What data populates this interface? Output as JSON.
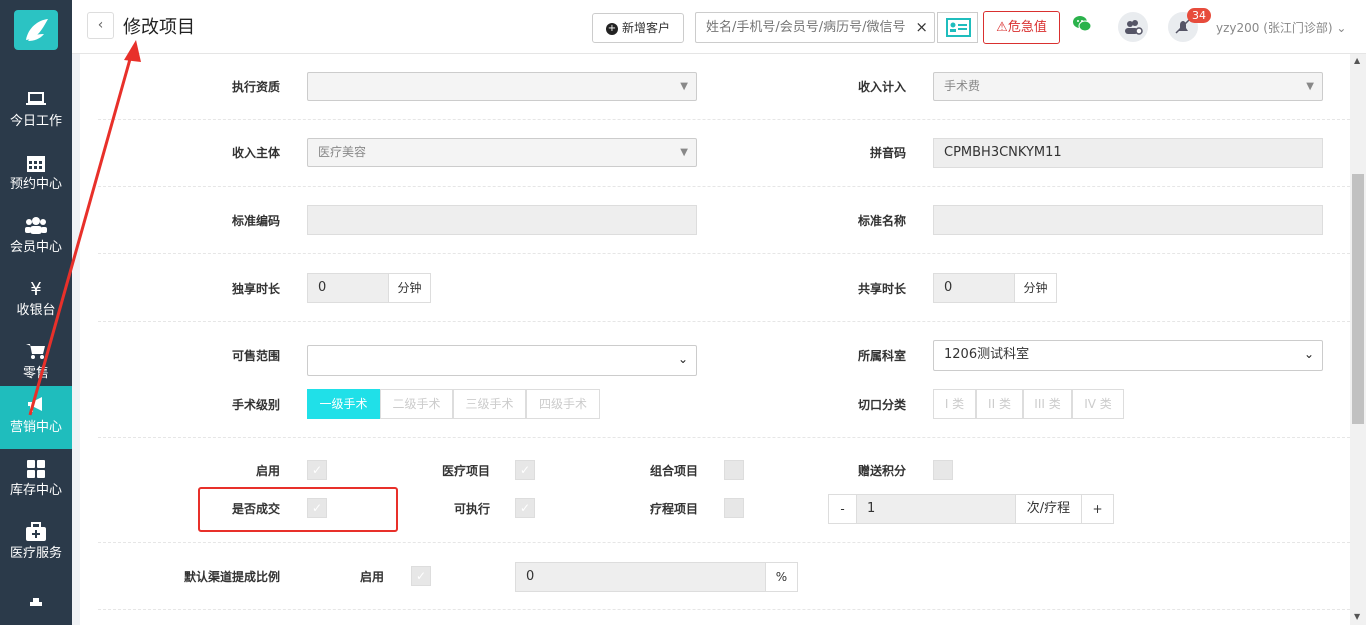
{
  "sidebar": {
    "items": [
      {
        "label": "今日工作",
        "icon": "laptop-icon"
      },
      {
        "label": "预约中心",
        "icon": "calendar-icon"
      },
      {
        "label": "会员中心",
        "icon": "users-icon"
      },
      {
        "label": "收银台",
        "icon": "yen-icon"
      },
      {
        "label": "零售",
        "icon": "cart-icon"
      },
      {
        "label": "营销中心",
        "icon": "megaphone-icon"
      },
      {
        "label": "库存中心",
        "icon": "grid-icon"
      },
      {
        "label": "医疗服务",
        "icon": "medkit-icon"
      }
    ]
  },
  "header": {
    "back": "‹",
    "title": "修改项目",
    "new_customer": "新增客户",
    "search_placeholder": "姓名/手机号/会员号/病历号/微信号",
    "clear": "×",
    "danger": "危急值",
    "notifications": "34",
    "user": "yzy200 (张江门诊部)"
  },
  "form": {
    "exec_qual_label": "执行资质",
    "exec_qual_value": "",
    "income_label": "收入计入",
    "income_value": "手术费",
    "income_subject_label": "收入主体",
    "income_subject_value": "医疗美容",
    "pinyin_label": "拼音码",
    "pinyin_value": "CPMBH3CNKYM11",
    "std_code_label": "标准编码",
    "std_code_value": "",
    "std_name_label": "标准名称",
    "std_name_value": "",
    "excl_time_label": "独享时长",
    "excl_time_value": "0",
    "excl_time_unit": "分钟",
    "share_time_label": "共享时长",
    "share_time_value": "0",
    "share_time_unit": "分钟",
    "sale_range_label": "可售范围",
    "sale_range_value": "",
    "dept_label": "所属科室",
    "dept_value": "1206测试科室",
    "surgery_level_label": "手术级别",
    "surgery_levels": [
      "一级手术",
      "二级手术",
      "三级手术",
      "四级手术"
    ],
    "incision_label": "切口分类",
    "incisions": [
      "I 类",
      "II 类",
      "III 类",
      "IV 类"
    ],
    "enable_label": "启用",
    "medical_label": "医疗项目",
    "combo_label": "组合项目",
    "bonus_label": "赠送积分",
    "deal_label": "是否成交",
    "exec_label": "可执行",
    "course_label": "疗程项目",
    "course_minus": "-",
    "course_value": "1",
    "course_unit": "次/疗程",
    "course_plus": "+",
    "channel_label": "默认渠道提成比例",
    "channel_enable_label": "启用",
    "channel_value": "0",
    "channel_unit": "%"
  },
  "colors": {
    "sidebar": "#2b3a4a",
    "active": "#1fbdbd",
    "danger": "#d9302f",
    "annotation": "#e8302a"
  }
}
